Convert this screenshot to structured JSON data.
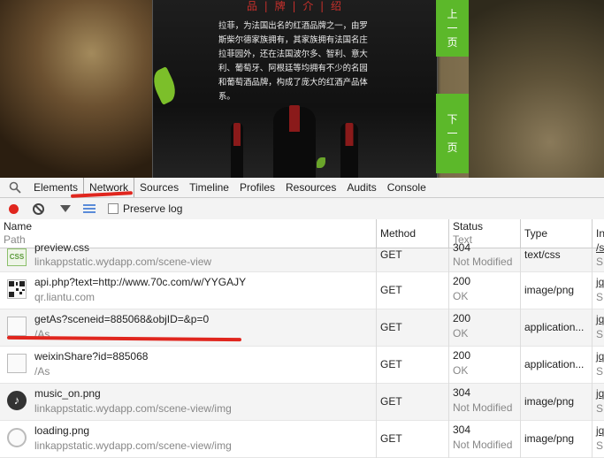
{
  "preview": {
    "title": "品 | 牌 | 介 | 绍",
    "text": "拉菲，为法国出名的红酒品牌之一，由罗斯柴尔德家族拥有，其家族拥有法国名庄拉菲园外，还在法国波尔多、智利、意大利、葡萄牙、阿根廷等均拥有不少的名园和葡萄酒品牌，构成了庞大的红酒产品体系。",
    "prev_label": [
      "上",
      "一",
      "页"
    ],
    "next_label": [
      "下",
      "一",
      "页"
    ],
    "accent_color": "#5cb82a"
  },
  "toolbar": {
    "tabs": [
      "Elements",
      "Network",
      "Sources",
      "Timeline",
      "Profiles",
      "Resources",
      "Audits",
      "Console"
    ],
    "selected": "Network"
  },
  "controls": {
    "preserve_log": "Preserve log"
  },
  "table": {
    "headers": {
      "name": "Name",
      "name_sub": "Path",
      "method": "Method",
      "status": "Status",
      "status_sub": "Text",
      "type": "Type",
      "initiator": "In"
    },
    "rows": [
      {
        "icon": "css-file-icon",
        "name": "preview.css",
        "path": "linkappstatic.wydapp.com/scene-view",
        "method": "GET",
        "status": "304",
        "status_text": "Not Modified",
        "type": "text/css",
        "init": "/s",
        "init2": "S"
      },
      {
        "icon": "qr-code-icon",
        "name": "api.php?text=http://www.70c.com/w/YYGAJY",
        "path": "qr.liantu.com",
        "method": "GET",
        "status": "200",
        "status_text": "OK",
        "type": "image/png",
        "init": "jq",
        "init2": "S"
      },
      {
        "icon": "blank-file-icon",
        "name": "getAs?sceneid=885068&objID=&p=0",
        "path": "/As",
        "method": "GET",
        "status": "200",
        "status_text": "OK",
        "type": "application...",
        "init": "jq",
        "init2": "S"
      },
      {
        "icon": "blank-file-icon",
        "name": "weixinShare?id=885068",
        "path": "/As",
        "method": "GET",
        "status": "200",
        "status_text": "OK",
        "type": "application...",
        "init": "jq",
        "init2": "S"
      },
      {
        "icon": "music-note-icon",
        "name": "music_on.png",
        "path": "linkappstatic.wydapp.com/scene-view/img",
        "method": "GET",
        "status": "304",
        "status_text": "Not Modified",
        "type": "image/png",
        "init": "jq",
        "init2": "S"
      },
      {
        "icon": "loading-image-icon",
        "name": "loading.png",
        "path": "linkappstatic.wydapp.com/scene-view/img",
        "method": "GET",
        "status": "304",
        "status_text": "Not Modified",
        "type": "image/png",
        "init": "jq",
        "init2": "S"
      }
    ]
  }
}
